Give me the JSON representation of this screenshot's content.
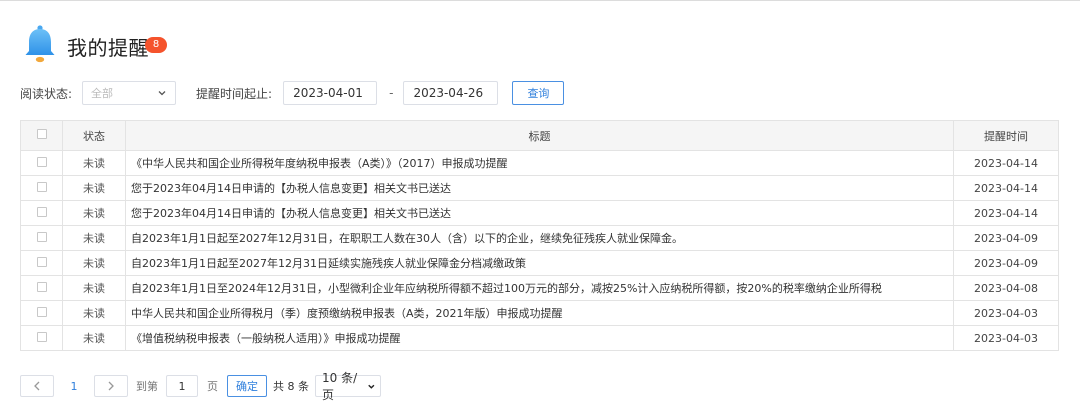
{
  "header": {
    "title": "我的提醒",
    "badge": "8"
  },
  "filters": {
    "read_status_label": "阅读状态:",
    "read_status_value": "全部",
    "date_range_label": "提醒时间起止:",
    "date_from": "2023-04-01",
    "date_separator": "-",
    "date_to": "2023-04-26",
    "query_label": "查询"
  },
  "table": {
    "columns": {
      "status": "状态",
      "title": "标题",
      "time": "提醒时间"
    },
    "rows": [
      {
        "status": "未读",
        "title": "《中华人民共和国企业所得税年度纳税申报表（A类）》（2017）申报成功提醒",
        "time": "2023-04-14"
      },
      {
        "status": "未读",
        "title": "您于2023年04月14日申请的【办税人信息变更】相关文书已送达",
        "time": "2023-04-14"
      },
      {
        "status": "未读",
        "title": "您于2023年04月14日申请的【办税人信息变更】相关文书已送达",
        "time": "2023-04-14"
      },
      {
        "status": "未读",
        "title": "自2023年1月1日起至2027年12月31日，在职职工人数在30人（含）以下的企业，继续免征残疾人就业保障金。",
        "time": "2023-04-09"
      },
      {
        "status": "未读",
        "title": "自2023年1月1日起至2027年12月31日延续实施残疾人就业保障金分档减缴政策",
        "time": "2023-04-09"
      },
      {
        "status": "未读",
        "title": "自2023年1月1日至2024年12月31日，小型微利企业年应纳税所得额不超过100万元的部分，减按25%计入应纳税所得额，按20%的税率缴纳企业所得税",
        "time": "2023-04-08"
      },
      {
        "status": "未读",
        "title": "中华人民共和国企业所得税月（季）度预缴纳税申报表（A类，2021年版）申报成功提醒",
        "time": "2023-04-03"
      },
      {
        "status": "未读",
        "title": "《增值税纳税申报表（一般纳税人适用）》申报成功提醒",
        "time": "2023-04-03"
      }
    ]
  },
  "pagination": {
    "current_page": "1",
    "goto_label": "到第",
    "goto_value": "1",
    "page_unit": "页",
    "confirm_label": "确定",
    "total_label": "共 8 条",
    "page_size": "10 条/页"
  },
  "icons": {
    "bell": "bell-icon",
    "dropdown": "chevron-down-icon",
    "prev": "chevron-left-icon",
    "next": "chevron-right-icon"
  },
  "colors": {
    "accent": "#2f7fdc",
    "badge": "#f5532c",
    "bell": "#4aa8f0"
  }
}
